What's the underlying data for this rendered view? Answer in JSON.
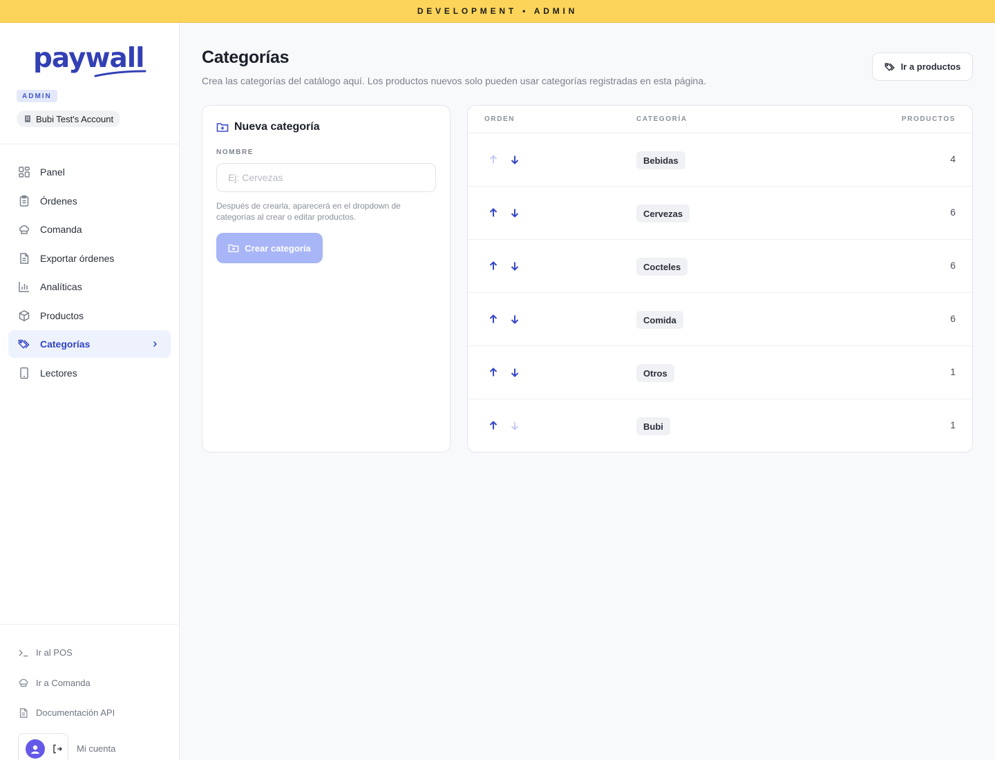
{
  "env_banner": "DEVELOPMENT • ADMIN",
  "sidebar": {
    "logo": "paywall",
    "role_badge": "ADMIN",
    "account": "Bubi Test's Account",
    "nav": [
      {
        "label": "Panel",
        "icon": "grid-icon"
      },
      {
        "label": "Órdenes",
        "icon": "clipboard-icon"
      },
      {
        "label": "Comanda",
        "icon": "chef-hat-icon"
      },
      {
        "label": "Exportar órdenes",
        "icon": "document-icon"
      },
      {
        "label": "Analíticas",
        "icon": "bar-chart-icon"
      },
      {
        "label": "Productos",
        "icon": "package-icon"
      },
      {
        "label": "Categorías",
        "icon": "tags-icon",
        "active": true
      },
      {
        "label": "Lectores",
        "icon": "tablet-icon"
      }
    ],
    "bottom_links": [
      {
        "label": "Ir al POS",
        "icon": "terminal-icon"
      },
      {
        "label": "Ir a Comanda",
        "icon": "chef-hat-icon"
      },
      {
        "label": "Documentación API",
        "icon": "document-icon"
      }
    ],
    "my_account": "Mi cuenta"
  },
  "page": {
    "title": "Categorías",
    "description": "Crea las categorías del catálogo aquí. Los productos nuevos solo pueden usar categorías registradas en esta página.",
    "goto_products": "Ir a productos"
  },
  "new_category": {
    "title": "Nueva categoría",
    "name_label": "NOMBRE",
    "name_placeholder": "Ej: Cervezas",
    "name_value": "",
    "hint": "Después de crearla, aparecerá en el dropdown de categorías al crear o editar productos.",
    "create_label": "Crear categoría",
    "create_enabled": false
  },
  "table": {
    "headers": {
      "order": "ORDEN",
      "category": "CATEGORÍA",
      "products": "PRODUCTOS"
    },
    "rows": [
      {
        "name": "Bebidas",
        "count": "4",
        "up_enabled": false,
        "down_enabled": true
      },
      {
        "name": "Cervezas",
        "count": "6",
        "up_enabled": true,
        "down_enabled": true
      },
      {
        "name": "Cocteles",
        "count": "6",
        "up_enabled": true,
        "down_enabled": true
      },
      {
        "name": "Comida",
        "count": "6",
        "up_enabled": true,
        "down_enabled": true
      },
      {
        "name": "Otros",
        "count": "1",
        "up_enabled": true,
        "down_enabled": true
      },
      {
        "name": "Bubi",
        "count": "1",
        "up_enabled": true,
        "down_enabled": false
      }
    ]
  },
  "colors": {
    "accent": "#3143c4",
    "banner": "#fcd45a",
    "button_disabled": "#a8b5f6"
  }
}
